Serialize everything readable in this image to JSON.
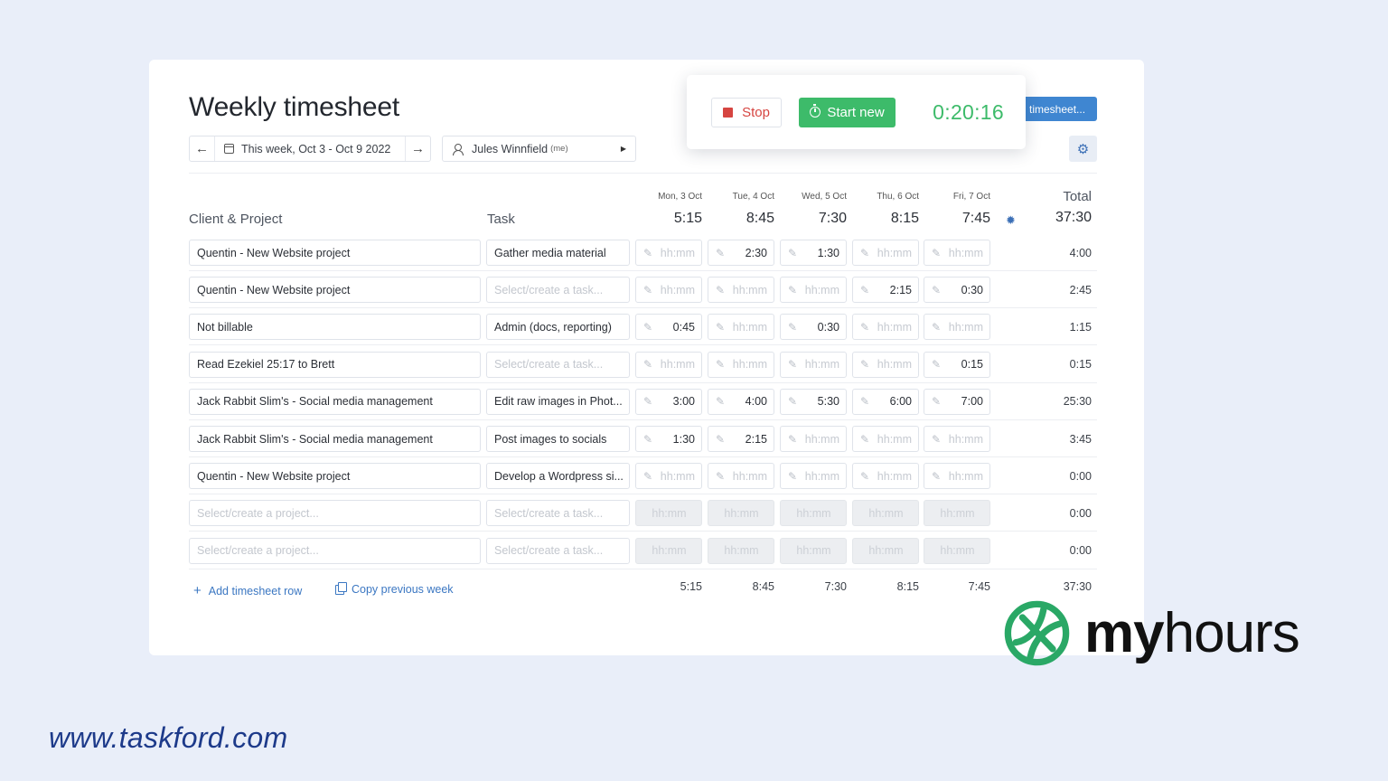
{
  "page": {
    "title": "Weekly timesheet"
  },
  "week": {
    "range": "This week, Oct 3 - Oct 9 2022"
  },
  "user": {
    "name": "Jules Winnfield",
    "suffix": "(me)"
  },
  "timer": {
    "stop_label": "Stop",
    "start_label": "Start new",
    "elapsed": "0:20:16"
  },
  "toolbar": {
    "timesheet_button": "timesheet..."
  },
  "table": {
    "col_project": "Client & Project",
    "col_task": "Task",
    "col_total": "Total",
    "grand_total": "37:30",
    "days": [
      {
        "label": "Mon, 3 Oct",
        "total": "5:15"
      },
      {
        "label": "Tue, 4 Oct",
        "total": "8:45"
      },
      {
        "label": "Wed, 5 Oct",
        "total": "7:30"
      },
      {
        "label": "Thu, 6 Oct",
        "total": "8:15"
      },
      {
        "label": "Fri, 7 Oct",
        "total": "7:45"
      }
    ],
    "placeholders": {
      "project": "Select/create a project...",
      "task": "Select/create a task...",
      "time": "hh:mm"
    },
    "rows": [
      {
        "project": "Quentin - New Website project",
        "task": "Gather media material",
        "times": [
          "",
          "2:30",
          "1:30",
          "",
          ""
        ],
        "total": "4:00"
      },
      {
        "project": "Quentin - New Website project",
        "task": "",
        "times": [
          "",
          "",
          "",
          "2:15",
          "0:30"
        ],
        "total": "2:45"
      },
      {
        "project": "Not billable",
        "task": "Admin (docs, reporting)",
        "times": [
          "0:45",
          "",
          "0:30",
          "",
          ""
        ],
        "total": "1:15"
      },
      {
        "project": "Read Ezekiel 25:17 to Brett",
        "task": "",
        "times": [
          "",
          "",
          "",
          "",
          "0:15"
        ],
        "total": "0:15"
      },
      {
        "project": "Jack Rabbit Slim's - Social media management",
        "task": "Edit raw images in Phot...",
        "times": [
          "3:00",
          "4:00",
          "5:30",
          "6:00",
          "7:00"
        ],
        "total": "25:30"
      },
      {
        "project": "Jack Rabbit Slim's - Social media management",
        "task": "Post images to socials",
        "times": [
          "1:30",
          "2:15",
          "",
          "",
          ""
        ],
        "total": "3:45"
      },
      {
        "project": "Quentin - New Website project",
        "task": "Develop a Wordpress si...",
        "times": [
          "",
          "",
          "",
          "",
          ""
        ],
        "total": "0:00"
      },
      {
        "project": "",
        "task": "",
        "times": [
          "",
          "",
          "",
          "",
          ""
        ],
        "total": "0:00",
        "empty": true
      },
      {
        "project": "",
        "task": "",
        "times": [
          "",
          "",
          "",
          "",
          ""
        ],
        "total": "0:00",
        "empty": true
      }
    ]
  },
  "footer": {
    "add_row": "Add timesheet row",
    "copy_week": "Copy previous week",
    "add_icon": "plus-icon",
    "copy_icon": "copy-icon"
  },
  "brand": {
    "logo_bold": "my",
    "logo_light": "hours",
    "logo_color": "#2aa866"
  },
  "watermark": {
    "site": "www.taskford.com"
  }
}
